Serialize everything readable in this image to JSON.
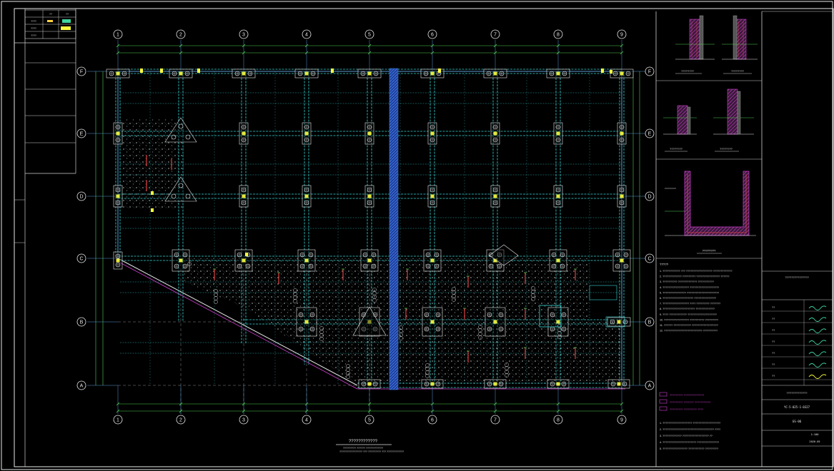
{
  "drawing": {
    "title": "????????????",
    "title_sub_1": "????????? ?????? ????????????",
    "title_sub_2": "???????????????? ??? ????????? ??? ????????????",
    "column_axes": [
      "1",
      "2",
      "3",
      "4",
      "5",
      "6",
      "7",
      "8",
      "9"
    ],
    "row_axes": [
      "F",
      "E",
      "D",
      "C",
      "B",
      "A"
    ]
  },
  "details": {
    "section_1": "????????",
    "section_2": "????????",
    "section_3": "????????",
    "section_4": "????????",
    "pit_title": "????????"
  },
  "notes": {
    "heading": "?????",
    "lines": [
      "1. ???????????? ??? ?????????????????? ?????????????",
      "2. ????????????? ????????? ???????????????? ??????",
      "3. ?????????? ????????????? ???????????",
      "4. ?????????????????? ????????????????????",
      "5. ???????????????? ??????????????????????",
      "6. ????????????????????? ???????????????",
      "7. ?????????????????? ???? ????????? ???????",
      "8. ?????????????????????? ?????????????",
      "9. ???? ???????????? ????????????????????",
      "10. ????????????????? ?????????? ?????????",
      "11. ?????? ???????????? ??????????????????",
      "12. ?????????????????????????? ??????????"
    ],
    "legend_lines": [
      "????????? ??????????????",
      "????????? ??????? ???????????",
      "????????? ????????? ????"
    ],
    "tail_lines": [
      "1. ???????????????????? ???????????????????",
      "2. ??????????????????????????????????? ????",
      "3. ????????????? ?????????????????? ??",
      "4. ??????????????????????? ???????????????",
      "5. ????????????????? ??????????? ?????????"
    ]
  },
  "title_block": {
    "project": "???????????????",
    "drawing_name": "?????????????",
    "drawing_no": "YC-5-025-1-0327",
    "sheet": "GS-06",
    "scale": "1:100",
    "date": "2020.05",
    "sign_labels": [
      "??",
      "??",
      "??",
      "??",
      "??",
      "??",
      "??"
    ]
  },
  "revision_table": {
    "headers": [
      "",
      "??",
      "??"
    ],
    "rows": [
      [
        "????",
        "",
        ""
      ],
      [
        "????",
        "",
        ""
      ],
      [
        "????",
        "",
        ""
      ]
    ]
  },
  "colors": {
    "background": "#000000",
    "border": "#e8e8e8",
    "axis_line": "#5b9bd5",
    "grid_cyan": "#38d6d6",
    "wall_blue": "#3a7ad8",
    "dim_green": "#4fce4f",
    "rebar_red": "#e04040",
    "hatch_magenta": "#d040d0",
    "highlight_yellow": "#ffff40"
  }
}
